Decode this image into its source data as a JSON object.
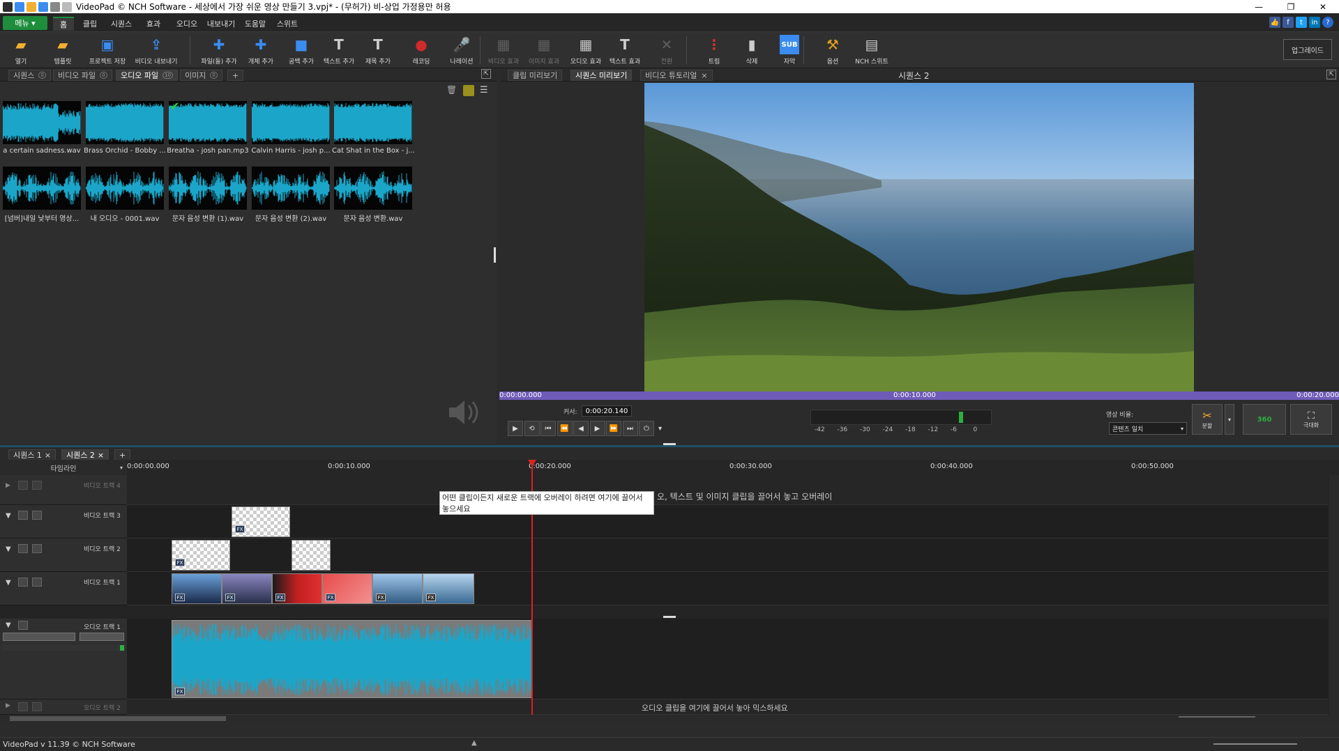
{
  "window": {
    "title": "VideoPad © NCH Software - 세상에서 가장 쉬운 영상 만들기 3.vpj* - (무허가) 비-상업 가정용만 허용",
    "controls": [
      "—",
      "❐",
      "✕"
    ]
  },
  "menu": {
    "menu_button": "메뉴 ▾",
    "tabs": [
      "홈",
      "클립",
      "시퀀스",
      "효과",
      "오디오",
      "내보내기",
      "도움말",
      "스위트"
    ],
    "active_tab": "홈",
    "social": [
      "👍",
      "f",
      "t",
      "in",
      "?"
    ]
  },
  "toolbar": {
    "buttons": [
      {
        "label": "열기",
        "icon": "folder-open-icon",
        "color": "#f0b030",
        "glyph": "▰"
      },
      {
        "label": "템플릿",
        "icon": "template-icon",
        "color": "#f0b030",
        "glyph": "▰"
      },
      {
        "label": "프로젝트 저장",
        "icon": "save-icon",
        "color": "#3a8cf0",
        "glyph": "▣"
      },
      {
        "label": "비디오 내보내기",
        "icon": "export-icon",
        "color": "#3a8cf0",
        "glyph": "⇪"
      },
      {
        "label": "파일(들) 추가",
        "icon": "add-file-icon",
        "color": "#3a8cf0",
        "glyph": "✚"
      },
      {
        "label": "개체 추가",
        "icon": "add-object-icon",
        "color": "#3a8cf0",
        "glyph": "✚"
      },
      {
        "label": "공백 추가",
        "icon": "add-blank-icon",
        "color": "#3a8cf0",
        "glyph": "■"
      },
      {
        "label": "텍스트 추가",
        "icon": "add-text-icon",
        "color": "#cccccc",
        "glyph": "T"
      },
      {
        "label": "제목 추가",
        "icon": "add-title-icon",
        "color": "#cccccc",
        "glyph": "T"
      },
      {
        "label": "레코딩",
        "icon": "record-icon",
        "color": "#d02a2a",
        "glyph": "●"
      },
      {
        "label": "나레이션",
        "icon": "narration-mic-icon",
        "color": "#c84848",
        "glyph": "🎤"
      },
      {
        "label": "비디오 효과",
        "icon": "video-effects-icon",
        "color": "#999999",
        "glyph": "▦",
        "disabled": true
      },
      {
        "label": "이미지 효과",
        "icon": "image-effects-icon",
        "color": "#999999",
        "glyph": "▦",
        "disabled": true
      },
      {
        "label": "오디오 효과",
        "icon": "audio-effects-icon",
        "color": "#cccccc",
        "glyph": "▦"
      },
      {
        "label": "텍스트 효과",
        "icon": "text-effects-icon",
        "color": "#cccccc",
        "glyph": "T"
      },
      {
        "label": "전환",
        "icon": "transition-icon",
        "color": "#999999",
        "glyph": "✕",
        "disabled": true
      },
      {
        "label": "트림",
        "icon": "trim-icon",
        "color": "#cc3333",
        "glyph": "⋮"
      },
      {
        "label": "삭제",
        "icon": "delete-trash-icon",
        "color": "#cccccc",
        "glyph": "▮"
      },
      {
        "label": "자막",
        "icon": "subtitle-icon",
        "color": "#3a8cf0",
        "glyph": "SUB"
      },
      {
        "label": "옵션",
        "icon": "options-tools-icon",
        "color": "#e0a020",
        "glyph": "⚒"
      },
      {
        "label": "NCH 스위트",
        "icon": "nch-suite-icon",
        "color": "#cccccc",
        "glyph": "▤"
      }
    ],
    "upgrade": "업그레이드"
  },
  "bin": {
    "tabs": [
      {
        "label": "시퀀스",
        "count": "0"
      },
      {
        "label": "비디오 파일",
        "count": "0"
      },
      {
        "label": "오디오 파일",
        "count": "10"
      },
      {
        "label": "이미지",
        "count": "0"
      },
      {
        "label": "+",
        "count": ""
      }
    ],
    "active_tab": "오디오 파일",
    "items": [
      {
        "name": "a certain sadness.wav",
        "style": "dense",
        "checked": false
      },
      {
        "name": "Brass Orchid - Bobby ...",
        "style": "full",
        "checked": false
      },
      {
        "name": "Breatha - josh pan.mp3",
        "style": "full",
        "checked": true
      },
      {
        "name": "Calvin Harris - josh p...",
        "style": "full",
        "checked": false
      },
      {
        "name": "Cat Shat in the Box - j...",
        "style": "full",
        "checked": false
      },
      {
        "name": "[넘버]내일 낮부터 영상...",
        "style": "speech",
        "checked": false
      },
      {
        "name": "내 오디오 - 0001.wav",
        "style": "speech",
        "checked": false
      },
      {
        "name": "문자 음성 변환 (1).wav",
        "style": "speech",
        "checked": false
      },
      {
        "name": "문자 음성 변환 (2).wav",
        "style": "speech",
        "checked": false
      },
      {
        "name": "문자 음성 변환.wav",
        "style": "speech",
        "checked": false
      }
    ]
  },
  "preview": {
    "tabs": [
      "클립 미리보기",
      "시퀀스 미리보기",
      "비디오 튜토리얼"
    ],
    "active_tab": "시퀀스 미리보기",
    "sequence_title": "시퀀스 2",
    "bar_times": [
      "0:00:00.000",
      "0:00:10.000",
      "0:00:20.000"
    ],
    "cursor_label": "커서:",
    "cursor_time": "0:00:20.140",
    "transport": [
      "▶",
      "⟲",
      "⏮",
      "⏪",
      "◀",
      "▶",
      "⏩",
      "⏭",
      "⏻",
      "▾"
    ],
    "meter_labels": [
      "-42",
      "-36",
      "-30",
      "-24",
      "-18",
      "-12",
      "-6",
      "0"
    ],
    "aspect_label": "영상 비율:",
    "aspect_value": "콘텐츠 일치",
    "split_label": "분할",
    "btn_360": "360",
    "fullscreen_label": "극대화"
  },
  "sequences": {
    "tabs": [
      "시퀀스 1",
      "시퀀스 2"
    ],
    "active_tab": "시퀀스 2",
    "add": "+"
  },
  "timeline": {
    "mode": "타임라인",
    "ruler": [
      "0:00:00.000",
      "0:00:10.000",
      "0:00:20.000",
      "0:00:30.000",
      "0:00:40.000",
      "0:00:50.000"
    ],
    "playhead_seconds": 20.14,
    "tracks": [
      "비디오 트랙 4",
      "비디오 트랙 3",
      "비디오 트랙 2",
      "비디오 트랙 1",
      "오디오 트랙 1",
      "오디오 트랙 2"
    ],
    "overlay_hint": "오, 텍스트 및 이미지 클립을 끌어서 놓고 오버레이",
    "tooltip": "어떤 클립이든지 새로운 트랙에 오버레이 하려면 여기에 끌어서 놓으세요",
    "audio_hint": "오디오 클립을 여기에 끌어서 놓아 믹스하세요",
    "fx": "FX"
  },
  "status": {
    "text": "VideoPad v 11.39 © NCH Software"
  }
}
